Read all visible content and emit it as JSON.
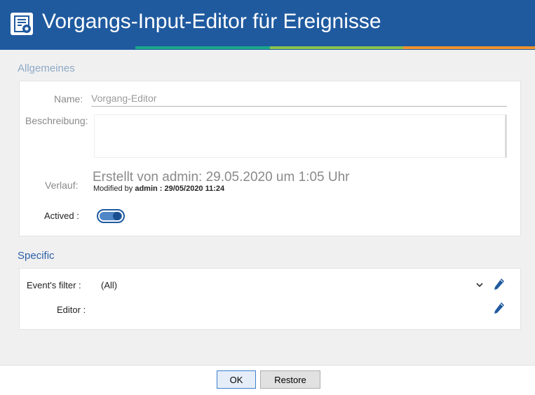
{
  "window": {
    "title": "Vorgangs-Input-Editor für Ereignisse",
    "title_icon": "editor-document-icon",
    "accent_colors": [
      "#1f5a9f",
      "#1aa889",
      "#8bc34a",
      "#f0932b"
    ]
  },
  "general": {
    "section_title": "Allgemeines",
    "name_label": "Name:",
    "name_placeholder": "Vorgang-Editor",
    "description_label": "Beschreibung:",
    "history_label": "Verlauf:",
    "history_created": "Erstellt von admin: 29.05.2020 um 1:05 Uhr",
    "history_modified_prefix": "Modified by",
    "history_modified_value": "admin : 29/05/2020 11:24",
    "actived_label": "Actived :",
    "actived": true
  },
  "specific": {
    "section_title": "Specific",
    "events_filter_label": "Event's filter :",
    "events_filter_value": "(All)",
    "editor_label": "Editor :"
  },
  "footer": {
    "ok_label": "OK",
    "restore_label": "Restore"
  },
  "colors": {
    "titlebar": "#1f5a9f",
    "section_general": "#8fa9c7",
    "section_specific": "#2d62a8",
    "toggle_on": "#1f5a9f",
    "pencil": "#1f5a9f"
  }
}
